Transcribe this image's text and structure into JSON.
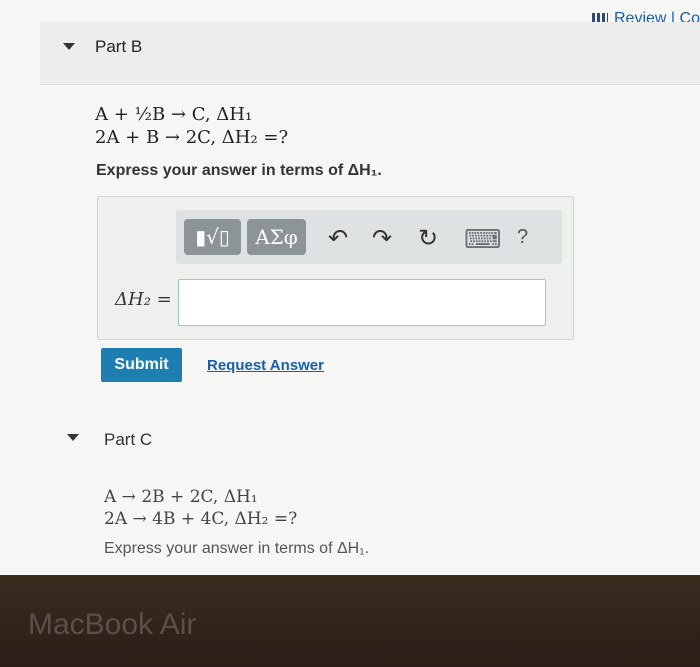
{
  "header": {
    "review_label": "Review | Co"
  },
  "partB": {
    "title": "Part B",
    "eq1": "A + ½B → C,  ΔH₁",
    "eq2": "2A + B → 2C,  ΔH₂ =?",
    "instruction": "Express your answer in terms of ΔH₁.",
    "toolbar": {
      "template_label": "▮√▯",
      "symbols_label": "ΑΣφ",
      "undo": "↶",
      "redo": "↷",
      "reset": "↻",
      "keyboard": "⌨",
      "help": "?"
    },
    "answer_label": "ΔH₂ =",
    "answer_value": "",
    "submit_label": "Submit",
    "request_label": "Request Answer"
  },
  "partC": {
    "title": "Part C",
    "eq1": "A → 2B + 2C,  ΔH₁",
    "eq2": "2A → 4B + 4C,  ΔH₂ =?",
    "instruction": "Express your answer in terms of ΔH₁."
  },
  "device": {
    "brand": "MacBook Air"
  }
}
